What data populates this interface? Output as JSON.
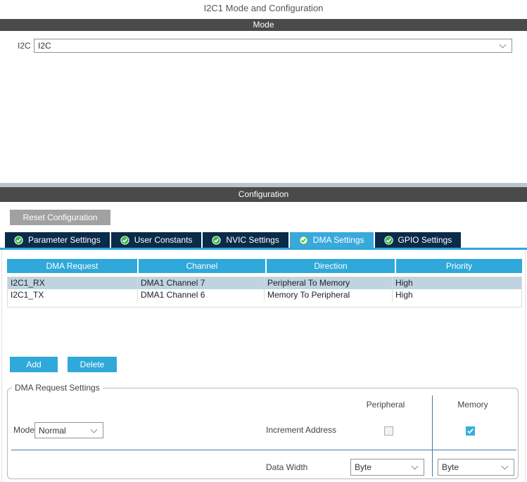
{
  "title": "I2C1 Mode and Configuration",
  "mode_section": {
    "header": "Mode",
    "label": "I2C",
    "dropdown_value": "I2C"
  },
  "config_section": {
    "header": "Configuration",
    "reset_button": "Reset Configuration",
    "tabs": [
      {
        "label": "Parameter Settings",
        "active": false
      },
      {
        "label": "User Constants",
        "active": false
      },
      {
        "label": "NVIC Settings",
        "active": false
      },
      {
        "label": "DMA Settings",
        "active": true
      },
      {
        "label": "GPIO Settings",
        "active": false
      }
    ]
  },
  "dma_table": {
    "columns": [
      "DMA Request",
      "Channel",
      "Direction",
      "Priority"
    ],
    "rows": [
      {
        "request": "I2C1_RX",
        "channel": "DMA1 Channel 7",
        "direction": "Peripheral To Memory",
        "priority": "High",
        "selected": true
      },
      {
        "request": "I2C1_TX",
        "channel": "DMA1 Channel 6",
        "direction": "Memory To Peripheral",
        "priority": "High",
        "selected": false
      }
    ],
    "add_button": "Add",
    "delete_button": "Delete"
  },
  "dma_request_settings": {
    "legend": "DMA Request Settings",
    "col_peripheral": "Peripheral",
    "col_memory": "Memory",
    "mode_label": "Mode",
    "mode_value": "Normal",
    "increment_label": "Increment Address",
    "peripheral_increment_checked": false,
    "memory_increment_checked": true,
    "data_width_label": "Data Width",
    "peripheral_data_width": "Byte",
    "memory_data_width": "Byte"
  },
  "colors": {
    "accent_blue": "#2fa8da",
    "active_tab_blue": "#39a9dc",
    "tab_navy": "#0a2b49",
    "bar_gray": "#4a4a4a",
    "strip_gray_blue": "#b9c5cd",
    "selected_row": "#bfd3e0",
    "check_green": "#3cb54a",
    "divider_blue": "#4a74ae",
    "reset_button_gray": "#a1a1a1"
  }
}
